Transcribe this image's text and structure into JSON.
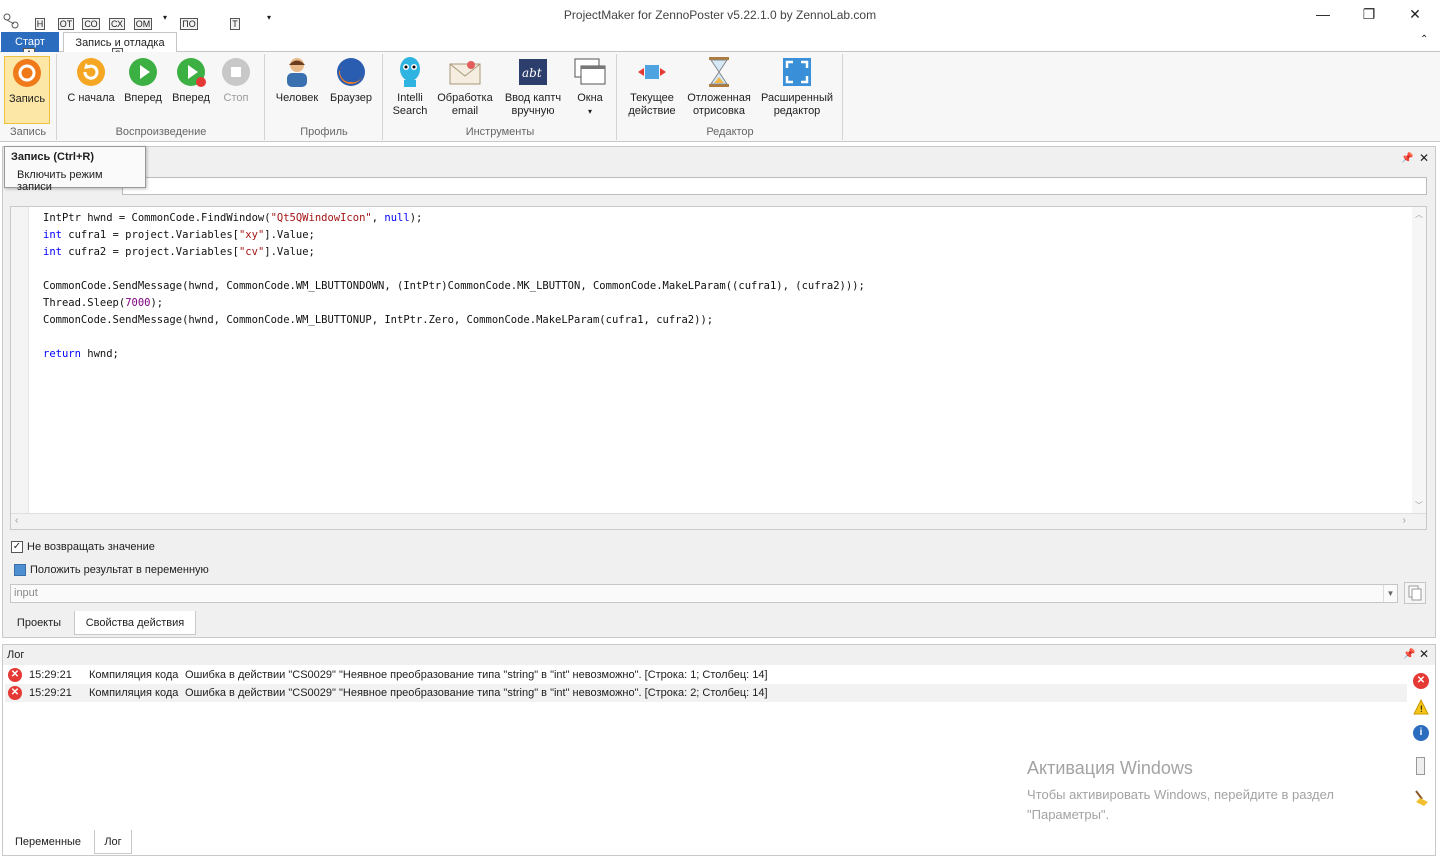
{
  "window": {
    "title": "ProjectMaker for ZennoPoster v5.22.1.0 by ZennoLab.com"
  },
  "quick_access": {
    "keytips": [
      "Н",
      "ОТ",
      "СО",
      "СХ",
      "ОМ",
      "ПО",
      "Т"
    ]
  },
  "ribbon": {
    "tabs": [
      {
        "label": "Старт",
        "active": true
      },
      {
        "label": "Запись и отладка"
      }
    ],
    "tab_keytips": [
      "А",
      "З"
    ],
    "groups": {
      "record": {
        "label": "Запись",
        "buttons": [
          {
            "label": "Запись"
          }
        ]
      },
      "playback": {
        "label": "Воспроизведение",
        "buttons": [
          {
            "label": "С начала"
          },
          {
            "label": "Вперед"
          },
          {
            "label": "Вперед"
          },
          {
            "label": "Стоп"
          }
        ]
      },
      "profile": {
        "label": "Профиль",
        "buttons": [
          {
            "label": "Человек"
          },
          {
            "label": "Браузер"
          }
        ]
      },
      "tools": {
        "label": "Инструменты",
        "buttons": [
          {
            "label1": "Intelli",
            "label2": "Search"
          },
          {
            "label1": "Обработка",
            "label2": "email"
          },
          {
            "label1": "Ввод каптч",
            "label2": "вручную"
          },
          {
            "label1": "Окна",
            "label2": "▾"
          }
        ]
      },
      "editor": {
        "label": "Редактор",
        "buttons": [
          {
            "label1": "Текущее",
            "label2": "действие"
          },
          {
            "label1": "Отложенная",
            "label2": "отрисовка"
          },
          {
            "label1": "Расширенный",
            "label2": "редактор"
          }
        ]
      }
    }
  },
  "tooltip": {
    "title": "Запись (Ctrl+R)",
    "description": "Включить режим записи"
  },
  "action_panel": {
    "no_return_label": "Не возвращать значение",
    "no_return_checked": true,
    "save_to_var_label": "Положить результат в переменную",
    "save_to_var_checked": false,
    "variable_value": "input"
  },
  "bottom_tabs": [
    {
      "label": "Проекты"
    },
    {
      "label": "Свойства действия",
      "active": true
    }
  ],
  "log": {
    "title": "Лог",
    "entries": [
      {
        "time": "15:29:21",
        "source": "Компиляция кода",
        "message": "Ошибка в действии \"CS0029\" \"Неявное преобразование типа \"string\" в \"int\" невозможно\". [Строка: 1; Столбец: 14]"
      },
      {
        "time": "15:29:21",
        "source": "Компиляция кода",
        "message": "Ошибка в действии \"CS0029\" \"Неявное преобразование типа \"string\" в \"int\" невозможно\". [Строка: 2; Столбец: 14]"
      }
    ],
    "tabs": [
      {
        "label": "Переменные"
      },
      {
        "label": "Лог",
        "active": true
      }
    ]
  },
  "activation": {
    "title": "Активация Windows",
    "line1": "Чтобы активировать Windows, перейдите в раздел",
    "line2": "\"Параметры\"."
  },
  "colors": {
    "accent": "#2b6cbf",
    "record_orange": "#f5a623",
    "error_red": "#e53935",
    "keyword_blue": "#0000ff",
    "string_red": "#a31515"
  }
}
